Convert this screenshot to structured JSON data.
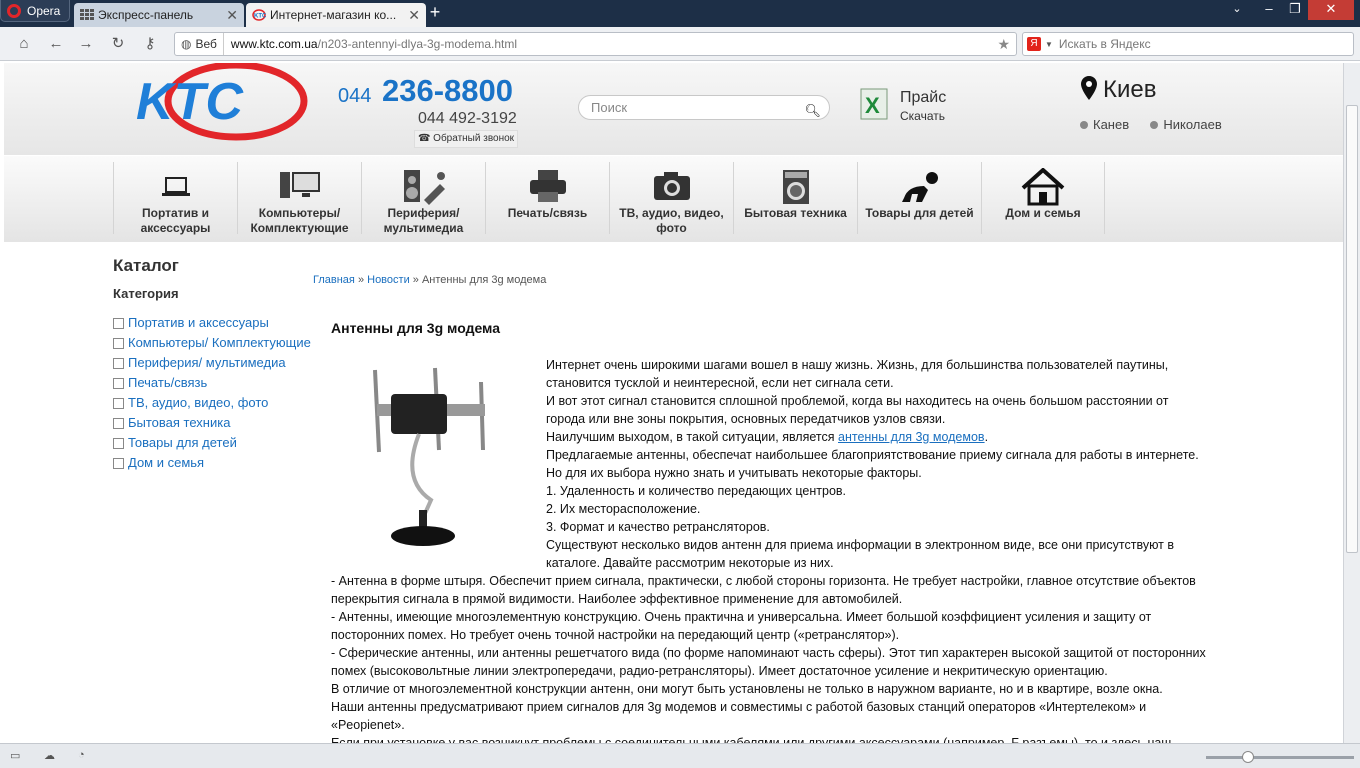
{
  "browser": {
    "menu_label": "Opera",
    "tabs": [
      {
        "label": "Экспресс-панель"
      },
      {
        "label": "Интернет-магазин ко..."
      }
    ],
    "address": {
      "badge": "Веб",
      "host": "www.ktc.com.ua",
      "path": "/n203-antennyi-dlya-3g-modema.html"
    },
    "search_placeholder": "Искать в Яндекс",
    "yandex_badge": "Я"
  },
  "header": {
    "phone_code": "044",
    "phone_main": "236-8800",
    "phone_secondary": "044 492-3192",
    "callback": "Обратный звонок",
    "search_placeholder": "Поиск",
    "price_title": "Прайс",
    "price_sub": "Скачать",
    "city": "Киев",
    "other_cities": [
      "Канев",
      "Николаев"
    ]
  },
  "nav": [
    {
      "label": "Портатив и аксессуары",
      "icon": "laptop-icon"
    },
    {
      "label": "Компьютеры/ Комплектующие",
      "icon": "computer-icon"
    },
    {
      "label": "Периферия/ мультимедиа",
      "icon": "speaker-icon"
    },
    {
      "label": "Печать/связь",
      "icon": "printer-icon"
    },
    {
      "label": "ТВ, аудио, видео, фото",
      "icon": "camera-icon"
    },
    {
      "label": "Бытовая техника",
      "icon": "washer-icon"
    },
    {
      "label": "Товары для детей",
      "icon": "baby-icon"
    },
    {
      "label": "Дом и семья",
      "icon": "house-icon"
    }
  ],
  "sidebar": {
    "title": "Каталог",
    "subtitle": "Категория",
    "categories": [
      "Портатив и аксессуары",
      "Компьютеры/ Комплектующие",
      "Периферия/ мультимедиа",
      "Печать/связь",
      "ТВ, аудио, видео, фото",
      "Бытовая техника",
      "Товары для детей",
      "Дом и семья"
    ]
  },
  "breadcrumb": {
    "home": "Главная",
    "sep": "»",
    "news": "Новости",
    "current": "Антенны для 3g модема"
  },
  "article": {
    "title": "Антенны для 3g модема",
    "p1": "Интернет очень широкими шагами вошел в нашу жизнь. Жизнь, для большинства пользователей паутины, становится тусклой и неинтересной, если нет сигнала сети.",
    "p2": "И вот этот сигнал становится сплошной проблемой, когда вы находитесь на очень большом расстоянии от города или вне зоны покрытия, основных передатчиков узлов связи.",
    "p3_pre": "Наилучшим выходом, в такой ситуации, является",
    "p3_link": "антенны для 3g модемов",
    "p3_post": ".",
    "p4": "Предлагаемые антенны, обеспечат наибольшее благоприятствование приему сигнала для работы в интернете. Но для их выбора нужно знать и учитывать некоторые факторы.",
    "l1": "1. Удаленность и количество передающих центров.",
    "l2": "2. Их месторасположение.",
    "l3": "3. Формат и качество ретрансляторов.",
    "p5": "Существуют несколько видов антенн для приема информации в электронном виде, все они присутствуют в каталоге. Давайте рассмотрим некоторые из них.",
    "p6": "- Антенна в форме штыря. Обеспечит прием сигнала, практически, с любой стороны горизонта. Не требует настройки, главное отсутствие объектов перекрытия сигнала в прямой видимости. Наиболее эффективное применение для автомобилей.",
    "p7": "- Антенны, имеющие многоэлементную конструкцию. Очень практична и универсальна. Имеет большой коэффициент усиления и защиту от посторонних помех. Но требует очень точной настройки на передающий центр («ретранслятор»).",
    "p8": "- Сферические антенны, или антенны решетчатого вида (по форме напоминают часть сферы). Этот тип характерен высокой защитой от посторонних помех (высоковольтные линии электропередачи, радио-ретрансляторы). Имеет достаточное усиление и некритическую ориентацию.",
    "p9": "В отличие от многоэлементной конструкции антенн, они могут быть установлены не только в наружном варианте, но и в квартире, возле окна.",
    "p10": "Наши антенны предусматривают прием сигналов для 3g модемов и совместимы с работой базовых станций операторов «Интертелеком» и «Peopienet».",
    "p11": "Если при установке у вас возникнут проблемы с соединительными кабелями или другими аксессуарами (например, F разъемы), то и здесь наш"
  },
  "colors": {
    "accent": "#1a73c7",
    "link": "#1a6fbf",
    "logo_red": "#e2262a"
  }
}
